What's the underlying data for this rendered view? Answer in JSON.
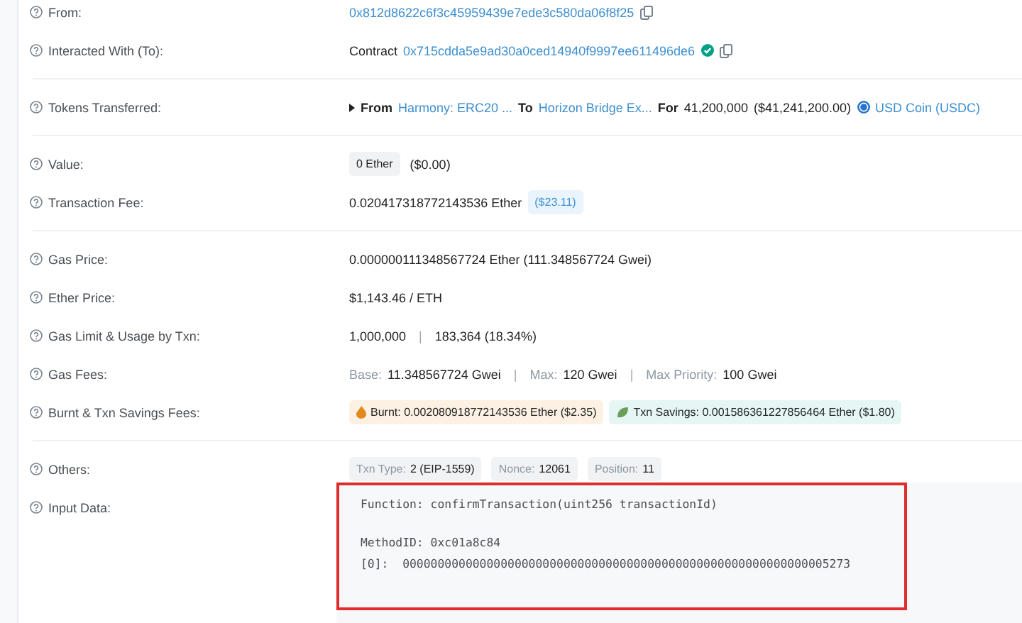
{
  "sections": [
    {
      "rows": [
        {
          "label": "From:",
          "value": [
            {
              "kind": "link",
              "text": "0x812d8622c6f3c45959439e7ede3c580da06f8f25"
            },
            {
              "kind": "copy"
            }
          ]
        },
        {
          "label": "Interacted With (To):",
          "value": [
            {
              "kind": "text",
              "text": "Contract"
            },
            {
              "kind": "link",
              "text": "0x715cdda5e9ad30a0ced14940f9997ee611496de6"
            },
            {
              "kind": "verified"
            },
            {
              "kind": "copy"
            }
          ]
        }
      ]
    },
    {
      "rows": [
        {
          "label": "Tokens Transferred:",
          "value": [
            {
              "kind": "caret"
            },
            {
              "kind": "strong",
              "text": "From"
            },
            {
              "kind": "link",
              "text": "Harmony: ERC20 ..."
            },
            {
              "kind": "strong",
              "text": "To"
            },
            {
              "kind": "link",
              "text": "Horizon Bridge Ex..."
            },
            {
              "kind": "strong",
              "text": "For"
            },
            {
              "kind": "text",
              "text": "41,200,000"
            },
            {
              "kind": "text",
              "text": "($41,241,200.00)"
            },
            {
              "kind": "coin"
            },
            {
              "kind": "link",
              "text": "USD Coin (USDC)"
            }
          ]
        }
      ]
    },
    {
      "rows": [
        {
          "label": "Value:",
          "value": [
            {
              "kind": "tag",
              "value": "0 Ether"
            },
            {
              "kind": "text",
              "text": "($0.00)"
            }
          ]
        },
        {
          "label": "Transaction Fee:",
          "value": [
            {
              "kind": "text",
              "text": "0.020417318772143536 Ether"
            },
            {
              "kind": "fee",
              "text": "($23.11)"
            }
          ]
        }
      ]
    },
    {
      "rows": [
        {
          "label": "Gas Price:",
          "value": [
            {
              "kind": "text",
              "text": "0.000000111348567724 Ether (111.348567724 Gwei)"
            }
          ]
        },
        {
          "label": "Ether Price:",
          "value": [
            {
              "kind": "text",
              "text": "$1,143.46 / ETH"
            }
          ]
        },
        {
          "label": "Gas Limit & Usage by Txn:",
          "value": [
            {
              "kind": "text",
              "text": "1,000,000"
            },
            {
              "kind": "sep",
              "text": "|"
            },
            {
              "kind": "text",
              "text": "183,364 (18.34%)"
            }
          ]
        },
        {
          "label": "Gas Fees:",
          "value": [
            {
              "kind": "muted",
              "text": "Base:"
            },
            {
              "kind": "text",
              "text": "11.348567724 Gwei"
            },
            {
              "kind": "sep",
              "text": "|"
            },
            {
              "kind": "muted",
              "text": "Max:"
            },
            {
              "kind": "text",
              "text": "120 Gwei"
            },
            {
              "kind": "sep",
              "text": "|"
            },
            {
              "kind": "muted",
              "text": "Max Priority:"
            },
            {
              "kind": "text",
              "text": "100 Gwei"
            }
          ]
        },
        {
          "label": "Burnt & Txn Savings Fees:",
          "value": [
            {
              "kind": "burnt",
              "text": "Burnt: 0.002080918772143536 Ether ($2.35)"
            },
            {
              "kind": "savings",
              "text": "Txn Savings: 0.001586361227856464 Ether ($1.80)"
            }
          ]
        }
      ]
    },
    {
      "rows": [
        {
          "label": "Others:",
          "value": [
            {
              "kind": "tag",
              "label": "Txn Type:",
              "value": "2 (EIP-1559)"
            },
            {
              "kind": "tag",
              "label": "Nonce:",
              "value": "12061"
            },
            {
              "kind": "tag",
              "label": "Position:",
              "value": "11"
            }
          ]
        },
        {
          "label": "Input Data:",
          "value": [
            {
              "kind": "code",
              "highlighted": true,
              "blocks": [
                [
                  "Function: confirmTransaction(uint256 transactionId)"
                ],
                [
                  "MethodID: 0xc01a8c84",
                  "[0]:  0000000000000000000000000000000000000000000000000000000000005273"
                ]
              ]
            }
          ]
        }
      ]
    }
  ]
}
